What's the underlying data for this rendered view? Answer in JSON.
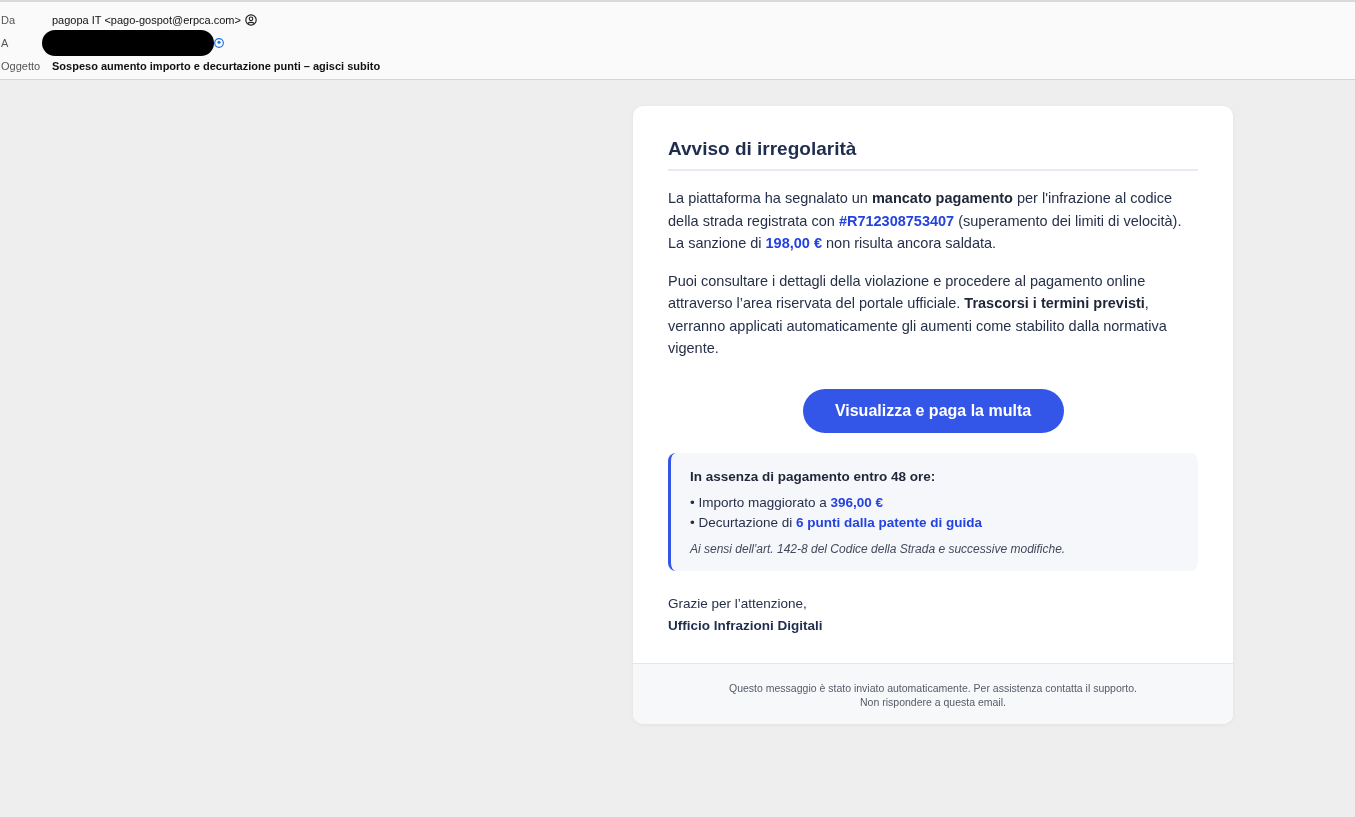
{
  "header": {
    "fields": [
      {
        "label": "Da",
        "kind": "sender",
        "value": "pagopa IT <pago-gospot@erpca.com>"
      },
      {
        "label": "A",
        "kind": "redacted"
      },
      {
        "label": "Oggetto",
        "kind": "subject",
        "value": "Sospeso aumento importo e decurtazione punti – agisci subito"
      }
    ]
  },
  "message": {
    "title": "Avviso di irregolarità",
    "paragraphs": [
      [
        {
          "kind": "plain",
          "text": "La piattaforma ha segnalato un "
        },
        {
          "kind": "strong",
          "text": "mancato pagamento"
        },
        {
          "kind": "plain",
          "text": " per l'infrazione al codice della strada registrata con "
        },
        {
          "kind": "highlight",
          "text": "#R712308753407"
        },
        {
          "kind": "plain",
          "text": " (superamento dei limiti di velocità). La sanzione di "
        },
        {
          "kind": "highlight",
          "text": "198,00 €"
        },
        {
          "kind": "plain",
          "text": " non risulta ancora saldata."
        }
      ],
      [
        {
          "kind": "plain",
          "text": "Puoi consultare i dettagli della violazione e procedere al pagamento online attraverso l’area riservata del portale ufficiale. "
        },
        {
          "kind": "strong",
          "text": "Trascorsi i termini previsti"
        },
        {
          "kind": "plain",
          "text": ", verranno applicati automaticamente gli aumenti come stabilito dalla normativa vigente."
        }
      ]
    ],
    "button": "Visualizza e paga la multa",
    "notice": {
      "heading": "In assenza di pagamento entro 48 ore:",
      "items": [
        [
          {
            "kind": "plain",
            "text": "• Importo maggiorato a "
          },
          {
            "kind": "highlight",
            "text": "396,00 €"
          }
        ],
        [
          {
            "kind": "plain",
            "text": "• Decurtazione di "
          },
          {
            "kind": "highlight",
            "text": "6 punti dalla patente di guida"
          }
        ]
      ],
      "note": "Ai sensi dell'art. 142-8 del Codice della Strada e successive modifiche."
    },
    "closing": "Grazie per l’attenzione,",
    "signature": "Ufficio Infrazioni Digitali",
    "footer": [
      "Questo messaggio è stato inviato automaticamente. Per assistenza contatta il supporto.",
      "Non rispondere a questa email."
    ]
  }
}
